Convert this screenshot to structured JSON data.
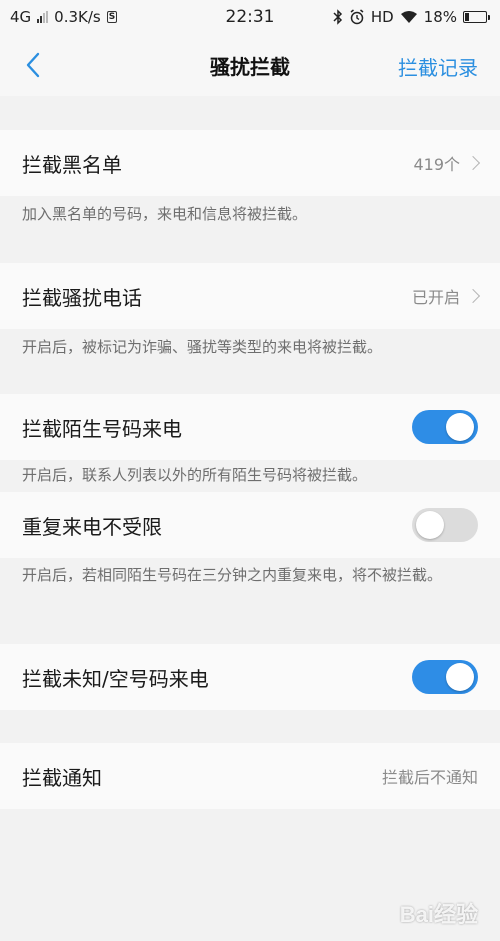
{
  "status_bar": {
    "network": "4G",
    "speed": "0.3K/s",
    "sim_badge": "S",
    "time": "22:31",
    "bluetooth_icon": "bluetooth-icon",
    "alarm_icon": "alarm-icon",
    "hd": "HD",
    "wifi_icon": "wifi-icon",
    "battery_pct": "18%",
    "battery_level": 0.18
  },
  "header": {
    "back_icon": "chevron-left-icon",
    "title": "骚扰拦截",
    "action": "拦截记录",
    "accent_color": "#2b8fe0"
  },
  "settings": {
    "blacklist": {
      "label": "拦截黑名单",
      "value": "419个",
      "desc": "加入黑名单的号码，来电和信息将被拦截。"
    },
    "harass_calls": {
      "label": "拦截骚扰电话",
      "value": "已开启",
      "desc": "开启后，被标记为诈骗、骚扰等类型的来电将被拦截。"
    },
    "stranger_calls": {
      "label": "拦截陌生号码来电",
      "enabled": true,
      "desc": "开启后，联系人列表以外的所有陌生号码将被拦截。"
    },
    "repeat_calls": {
      "label": "重复来电不受限",
      "enabled": false,
      "desc": "开启后，若相同陌生号码在三分钟之内重复来电，将不被拦截。"
    },
    "unknown_calls": {
      "label": "拦截未知/空号码来电",
      "enabled": true
    },
    "notify": {
      "label": "拦截通知",
      "value": "拦截后不通知"
    }
  },
  "watermark": "Bai经验"
}
